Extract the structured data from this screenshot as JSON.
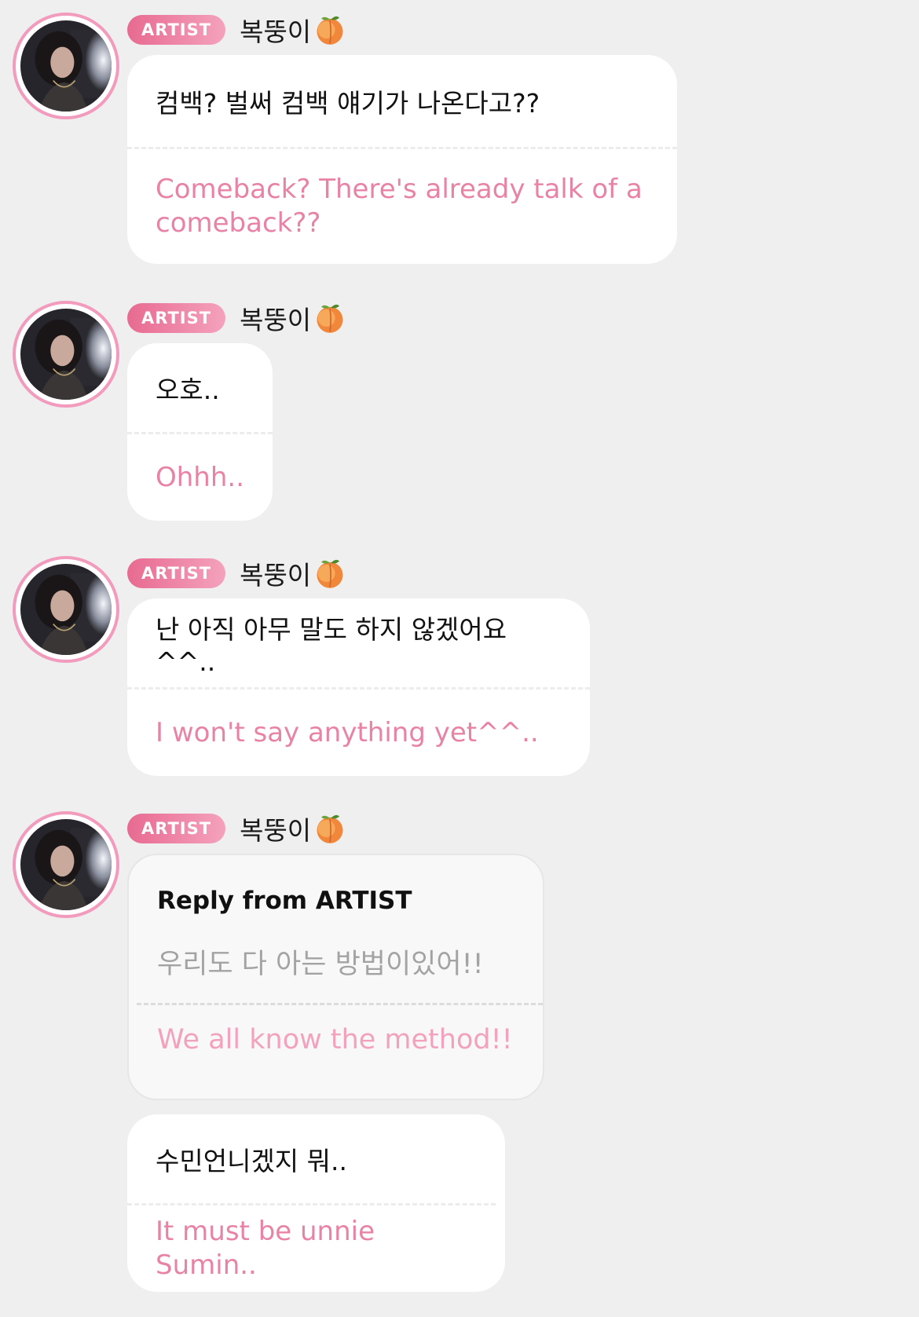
{
  "artist": {
    "badge_label": "ARTIST",
    "nickname": "복뚱이",
    "nickname_emoji": "peach-icon",
    "avatar_icon": "artist-avatar"
  },
  "colors": {
    "accent_pink": "#e983a6",
    "badge_gradient_start": "#e86a91",
    "badge_gradient_end": "#f4a2bd",
    "background": "#efefef",
    "bubble": "#ffffff"
  },
  "messages": [
    {
      "original": "컴백? 벌써 컴백 얘기가 나온다고??",
      "translation": "Comeback? There's already talk of a comeback??"
    },
    {
      "original": "오호..",
      "translation": "Ohhh.."
    },
    {
      "original": "난 아직 아무 말도 하지 않겠어요^^..",
      "translation": "I won't say anything yet^^.."
    },
    {
      "reply_title": "Reply from ARTIST",
      "quoted_original": "우리도 다 아는 방법이있어!!",
      "quoted_translation": "We all know the method!!"
    },
    {
      "original": "수민언니겠지 뭐..",
      "translation": "It must be unnie Sumin.."
    }
  ]
}
